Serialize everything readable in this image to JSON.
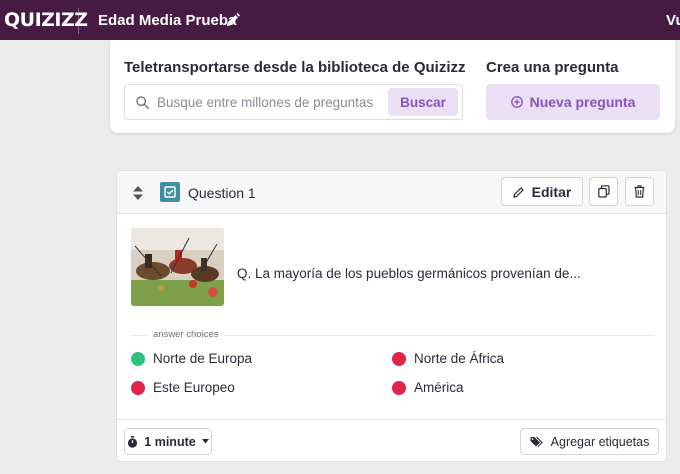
{
  "topbar": {
    "logo": "QUIZIZZ",
    "quiz_title": "Edad Media Prueba",
    "right_text": "Vu"
  },
  "import_panel": {
    "heading": "Teletransportarse desde la biblioteca de Quizizz",
    "search_placeholder": "Busque entre millones de preguntas",
    "search_value": "",
    "search_button": "Buscar"
  },
  "create_panel": {
    "heading": "Crea una pregunta",
    "new_question_button": "Nueva pregunta"
  },
  "question": {
    "label": "Question 1",
    "edit_button": "Editar",
    "text": "Q. La mayoría de los pueblos germánicos provenían de...",
    "answer_choices_label": "answer choices",
    "options": [
      {
        "text": "Norte de Europa",
        "correct": true
      },
      {
        "text": "Norte de África",
        "correct": false
      },
      {
        "text": "Este Europeo",
        "correct": false
      },
      {
        "text": "América",
        "correct": false
      }
    ],
    "time_button": "1 minute",
    "tags_button": "Agregar etiquetas"
  },
  "colors": {
    "topbar": "#461a42",
    "accent": "#8854c0",
    "accent_bg": "#eadff5",
    "correct": "#2ec17c",
    "incorrect": "#e0244a",
    "question_type": "#3e8fa0"
  },
  "icons": [
    "pencil-icon",
    "search-icon",
    "plus-circle-icon",
    "drag-handle-icon",
    "checkbox-icon",
    "copy-icon",
    "trash-icon",
    "stopwatch-icon",
    "caret-down-icon",
    "tag-icon"
  ]
}
